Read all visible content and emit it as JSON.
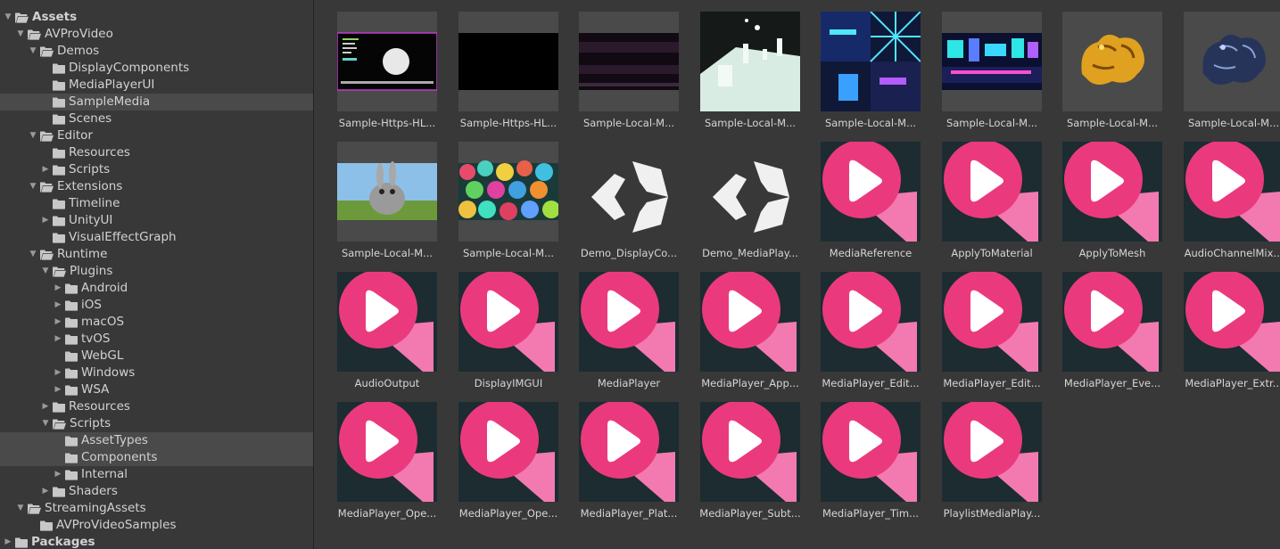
{
  "tree": [
    {
      "label": "Assets",
      "depth": 0,
      "arrow": "down",
      "open": true,
      "bold": true,
      "selected": false
    },
    {
      "label": "AVProVideo",
      "depth": 1,
      "arrow": "down",
      "open": true,
      "selected": false
    },
    {
      "label": "Demos",
      "depth": 2,
      "arrow": "down",
      "open": true,
      "selected": false
    },
    {
      "label": "DisplayComponents",
      "depth": 3,
      "arrow": "none",
      "open": false,
      "selected": false
    },
    {
      "label": "MediaPlayerUI",
      "depth": 3,
      "arrow": "none",
      "open": false,
      "selected": false
    },
    {
      "label": "SampleMedia",
      "depth": 3,
      "arrow": "none",
      "open": false,
      "selected": true
    },
    {
      "label": "Scenes",
      "depth": 3,
      "arrow": "none",
      "open": false,
      "selected": false
    },
    {
      "label": "Editor",
      "depth": 2,
      "arrow": "down",
      "open": true,
      "selected": false
    },
    {
      "label": "Resources",
      "depth": 3,
      "arrow": "none",
      "open": false,
      "selected": false
    },
    {
      "label": "Scripts",
      "depth": 3,
      "arrow": "right",
      "open": false,
      "selected": false
    },
    {
      "label": "Extensions",
      "depth": 2,
      "arrow": "down",
      "open": true,
      "selected": false
    },
    {
      "label": "Timeline",
      "depth": 3,
      "arrow": "none",
      "open": false,
      "selected": false
    },
    {
      "label": "UnityUI",
      "depth": 3,
      "arrow": "right",
      "open": false,
      "selected": false
    },
    {
      "label": "VisualEffectGraph",
      "depth": 3,
      "arrow": "none",
      "open": false,
      "selected": false
    },
    {
      "label": "Runtime",
      "depth": 2,
      "arrow": "down",
      "open": true,
      "selected": false
    },
    {
      "label": "Plugins",
      "depth": 3,
      "arrow": "down",
      "open": true,
      "selected": false
    },
    {
      "label": "Android",
      "depth": 4,
      "arrow": "right",
      "open": false,
      "selected": false
    },
    {
      "label": "iOS",
      "depth": 4,
      "arrow": "right",
      "open": false,
      "selected": false
    },
    {
      "label": "macOS",
      "depth": 4,
      "arrow": "right",
      "open": false,
      "selected": false
    },
    {
      "label": "tvOS",
      "depth": 4,
      "arrow": "right",
      "open": false,
      "selected": false
    },
    {
      "label": "WebGL",
      "depth": 4,
      "arrow": "none",
      "open": false,
      "selected": false
    },
    {
      "label": "Windows",
      "depth": 4,
      "arrow": "right",
      "open": false,
      "selected": false
    },
    {
      "label": "WSA",
      "depth": 4,
      "arrow": "right",
      "open": false,
      "selected": false
    },
    {
      "label": "Resources",
      "depth": 3,
      "arrow": "right",
      "open": false,
      "selected": false
    },
    {
      "label": "Scripts",
      "depth": 3,
      "arrow": "down",
      "open": true,
      "selected": false
    },
    {
      "label": "AssetTypes",
      "depth": 4,
      "arrow": "none",
      "open": false,
      "selected": true
    },
    {
      "label": "Components",
      "depth": 4,
      "arrow": "none",
      "open": false,
      "selected": true
    },
    {
      "label": "Internal",
      "depth": 4,
      "arrow": "right",
      "open": false,
      "selected": false
    },
    {
      "label": "Shaders",
      "depth": 3,
      "arrow": "right",
      "open": false,
      "selected": false
    },
    {
      "label": "StreamingAssets",
      "depth": 1,
      "arrow": "down",
      "open": true,
      "selected": false
    },
    {
      "label": "AVProVideoSamples",
      "depth": 2,
      "arrow": "none",
      "open": false,
      "selected": false
    },
    {
      "label": "Packages",
      "depth": 0,
      "arrow": "right",
      "open": false,
      "bold": true,
      "selected": false
    }
  ],
  "assets": [
    {
      "label": "Sample-Https-HL...",
      "thumb": "hls-ui"
    },
    {
      "label": "Sample-Https-HL...",
      "thumb": "black"
    },
    {
      "label": "Sample-Local-M...",
      "thumb": "stripes"
    },
    {
      "label": "Sample-Local-M...",
      "thumb": "white-scene"
    },
    {
      "label": "Sample-Local-M...",
      "thumb": "cyber-quad"
    },
    {
      "label": "Sample-Local-M...",
      "thumb": "cyber-pano"
    },
    {
      "label": "Sample-Local-M...",
      "thumb": "dragon-gold"
    },
    {
      "label": "Sample-Local-M...",
      "thumb": "dragon-blue"
    },
    {
      "label": "Sample-Local-M...",
      "thumb": "bunny"
    },
    {
      "label": "Sample-Local-M...",
      "thumb": "spheres"
    },
    {
      "label": "Demo_DisplayCo...",
      "thumb": "unity-logo"
    },
    {
      "label": "Demo_MediaPlay...",
      "thumb": "unity-logo"
    },
    {
      "label": "MediaReference",
      "thumb": "avpro-icon"
    },
    {
      "label": "ApplyToMaterial",
      "thumb": "avpro-icon"
    },
    {
      "label": "ApplyToMesh",
      "thumb": "avpro-icon"
    },
    {
      "label": "AudioChannelMix...",
      "thumb": "avpro-icon"
    },
    {
      "label": "AudioOutput",
      "thumb": "avpro-icon"
    },
    {
      "label": "DisplayIMGUI",
      "thumb": "avpro-icon"
    },
    {
      "label": "MediaPlayer",
      "thumb": "avpro-icon"
    },
    {
      "label": "MediaPlayer_App...",
      "thumb": "avpro-icon"
    },
    {
      "label": "MediaPlayer_Edit...",
      "thumb": "avpro-icon"
    },
    {
      "label": "MediaPlayer_Edit...",
      "thumb": "avpro-icon"
    },
    {
      "label": "MediaPlayer_Eve...",
      "thumb": "avpro-icon"
    },
    {
      "label": "MediaPlayer_Extr...",
      "thumb": "avpro-icon"
    },
    {
      "label": "MediaPlayer_Ope...",
      "thumb": "avpro-icon"
    },
    {
      "label": "MediaPlayer_Ope...",
      "thumb": "avpro-icon"
    },
    {
      "label": "MediaPlayer_Plat...",
      "thumb": "avpro-icon"
    },
    {
      "label": "MediaPlayer_Subt...",
      "thumb": "avpro-icon"
    },
    {
      "label": "MediaPlayer_Tim...",
      "thumb": "avpro-icon"
    },
    {
      "label": "PlaylistMediaPlay...",
      "thumb": "avpro-icon"
    }
  ],
  "colors": {
    "background": "#383838",
    "selection": "#4a4a4a",
    "thumb_bg": "#4a4a4a",
    "avpro_bg": "#1c2c31",
    "avpro_pink": "#ea3a7d",
    "avpro_pink_light": "#f27ab0"
  }
}
